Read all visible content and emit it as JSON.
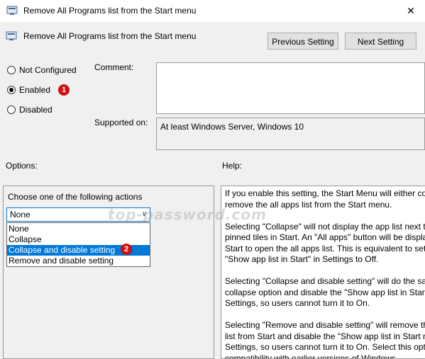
{
  "window": {
    "title": "Remove All Programs list from the Start menu",
    "close_glyph": "✕"
  },
  "header": {
    "setting_title": "Remove All Programs list from the Start menu",
    "previous_label": "Previous Setting",
    "next_label": "Next Setting"
  },
  "state": {
    "options": [
      {
        "label": "Not Configured",
        "checked": false
      },
      {
        "label": "Enabled",
        "checked": true
      },
      {
        "label": "Disabled",
        "checked": false
      }
    ]
  },
  "badges": [
    "1",
    "2"
  ],
  "comment_label": "Comment:",
  "supported_label": "Supported on:",
  "supported_value": "At least Windows Server, Windows 10",
  "options_label": "Options:",
  "help_label": "Help:",
  "options_panel": {
    "prompt": "Choose one of the following actions",
    "selected": "None",
    "dropdown_items": [
      "None",
      "Collapse",
      "Collapse and disable setting",
      "Remove and disable setting"
    ],
    "highlighted_index": 2
  },
  "help_text": [
    [
      "If you enable this setting, the Start Menu will either co",
      "remove the all apps list from the Start menu."
    ],
    [
      "Selecting \"Collapse\" will not display the app list next t",
      "pinned tiles in Start. An \"All apps\" button will be displa",
      "Start to open the all apps list. This is equivalent to sett",
      "\"Show app list in Start\" in Settings to Off."
    ],
    [
      "Selecting \"Collapse and disable setting\" will do the sa",
      "collapse option and disable the \"Show app list in Start",
      "Settings, so users cannot turn it to On."
    ],
    [
      "Selecting \"Remove and disable setting\" will remove the",
      "list from Start and disable the \"Show app list in Start m",
      "Settings, so users cannot turn it to On. Select this optio",
      "compatibility with earlier versions of Windows."
    ]
  ],
  "watermark": "top-password.com",
  "colors": {
    "accent": "#0078d7",
    "badge": "#d10f0f"
  }
}
